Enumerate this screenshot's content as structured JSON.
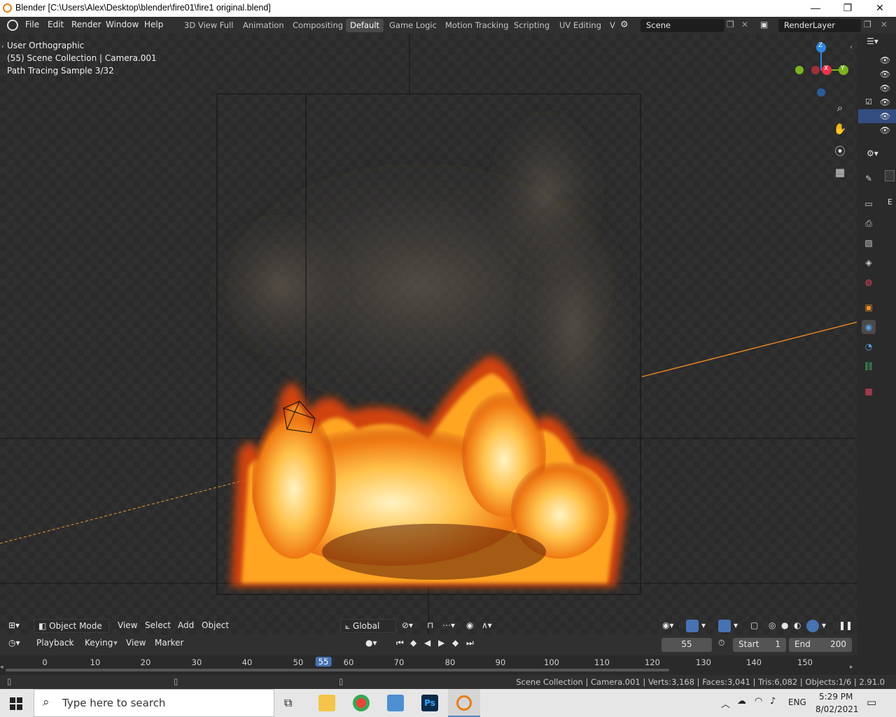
{
  "window": {
    "title": "Blender [C:\\Users\\Alex\\Desktop\\blender\\fire01\\fire1 original.blend]",
    "minimize": "—",
    "maximize": "❐",
    "close": "✕"
  },
  "menu": [
    "File",
    "Edit",
    "Render",
    "Window",
    "Help"
  ],
  "workspaces": [
    {
      "label": "3D View Full",
      "active": false
    },
    {
      "label": "Animation",
      "active": false
    },
    {
      "label": "Compositing",
      "active": false
    },
    {
      "label": "Default",
      "active": true
    },
    {
      "label": "Game Logic",
      "active": false
    },
    {
      "label": "Motion Tracking",
      "active": false
    },
    {
      "label": "Scripting",
      "active": false
    },
    {
      "label": "UV Editing",
      "active": false
    },
    {
      "label": "V",
      "active": false
    }
  ],
  "scene": {
    "name": "Scene",
    "render_layer": "RenderLayer"
  },
  "viewport": {
    "view_name": "User Orthographic",
    "collection_line": "(55) Scene Collection | Camera.001",
    "sample_line": "Path Tracing Sample 3/32",
    "gizmo": {
      "z": "Z",
      "x": "X",
      "y": "Y"
    }
  },
  "header3d": {
    "mode": "Object Mode",
    "items": [
      "View",
      "Select",
      "Add",
      "Object"
    ],
    "orientation": "Global"
  },
  "timeline": {
    "menus": [
      "Playback",
      "Keying",
      "View",
      "Marker"
    ],
    "current_frame": "55",
    "start_label": "Start",
    "start": "1",
    "end_label": "End",
    "end": "200",
    "ticks": [
      "0",
      "10",
      "20",
      "30",
      "40",
      "50",
      "55",
      "60",
      "70",
      "80",
      "90",
      "100",
      "110",
      "120",
      "130",
      "140",
      "150"
    ]
  },
  "status": {
    "text": "Scene Collection | Camera.001 | Verts:3,168 | Faces:3,041 | Tris:6,082 | Objects:1/6 | 2.91.0"
  },
  "props_tab": "E",
  "taskbar": {
    "search_placeholder": "Type here to search",
    "lang": "ENG",
    "time": "5:29 PM",
    "date": "8/02/2021",
    "ps_label": "Ps"
  },
  "colors": {
    "accent": "#4772b3",
    "fire_core": "#fff1b0",
    "fire_mid": "#ffa524",
    "fire_edge": "#d9440a",
    "axis_x": "#e8334a",
    "axis_y": "#7ab31e",
    "axis_z": "#2e86de"
  }
}
